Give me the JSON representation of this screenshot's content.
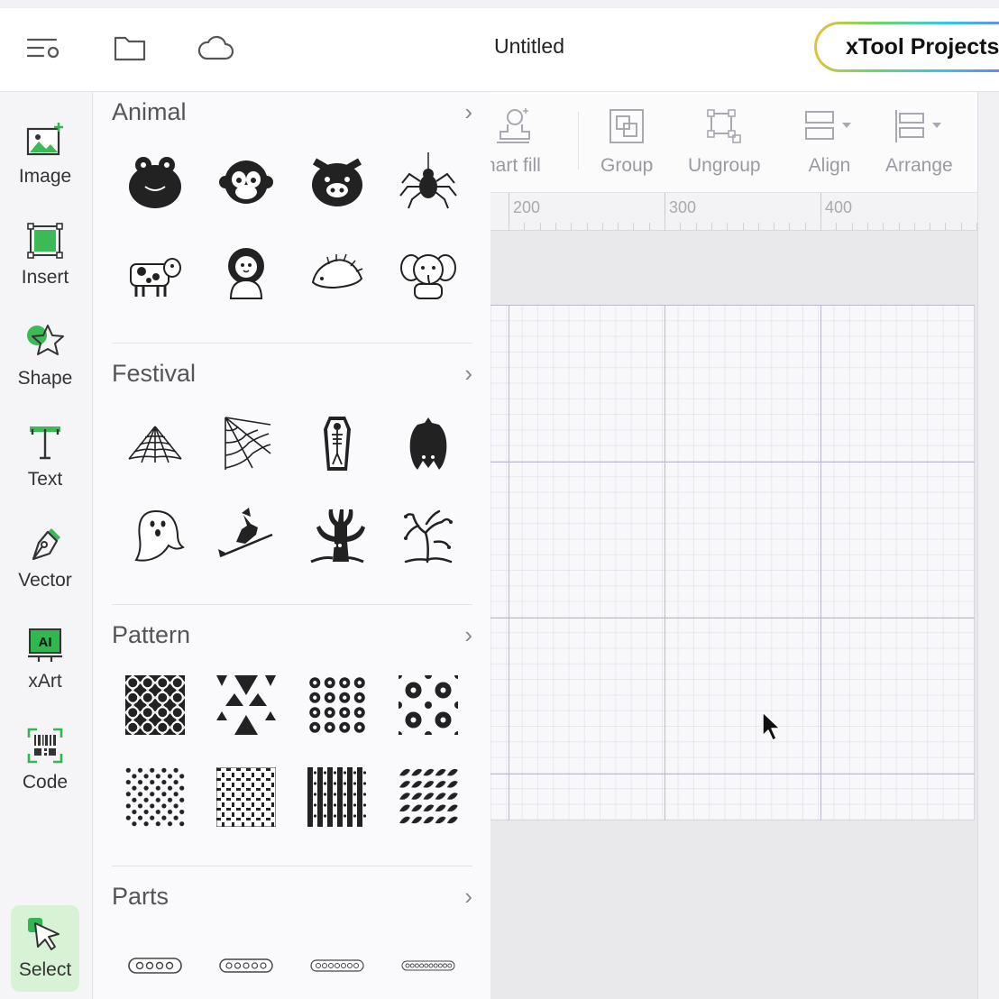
{
  "header": {
    "title": "Untitled",
    "project_button": "xTool Projects",
    "icons": [
      "settings-menu-icon",
      "folder-icon",
      "cloud-icon"
    ]
  },
  "rail": {
    "items": [
      {
        "label": "Image",
        "icon": "image-icon"
      },
      {
        "label": "Insert",
        "icon": "insert-icon"
      },
      {
        "label": "Shape",
        "icon": "star-icon"
      },
      {
        "label": "Text",
        "icon": "text-icon"
      },
      {
        "label": "Vector",
        "icon": "pen-icon"
      },
      {
        "label": "xArt",
        "icon": "ai-icon"
      },
      {
        "label": "Code",
        "icon": "barcode-icon"
      }
    ],
    "select_label": "Select"
  },
  "library": {
    "sections": [
      {
        "title": "Animal",
        "items": [
          "frog",
          "monkey",
          "pig",
          "spider",
          "cow",
          "lion",
          "hedgehog",
          "elephant"
        ]
      },
      {
        "title": "Festival",
        "items": [
          "spider-web",
          "corner-web",
          "coffin-skeleton",
          "bat",
          "ghost",
          "witch",
          "spooky-tree",
          "dead-tree"
        ]
      },
      {
        "title": "Pattern",
        "items": [
          "circles-pattern",
          "triangles-pattern",
          "flowers-pattern",
          "flower-grid-pattern",
          "dots-pattern",
          "weave-pattern",
          "stripes-pattern",
          "waves-pattern"
        ]
      },
      {
        "title": "Parts",
        "items": [
          "hole-strip-4",
          "hole-strip-5",
          "hole-strip-7",
          "hole-strip-10"
        ]
      }
    ]
  },
  "toolbar": {
    "smart_fill": "nart fill",
    "group": "Group",
    "ungroup": "Ungroup",
    "align": "Align",
    "arrange": "Arrange"
  },
  "ruler": {
    "labels": [
      "200",
      "300",
      "400"
    ]
  },
  "colors": {
    "accent_green": "#2fb84f",
    "select_bg": "#d8f2d6"
  }
}
